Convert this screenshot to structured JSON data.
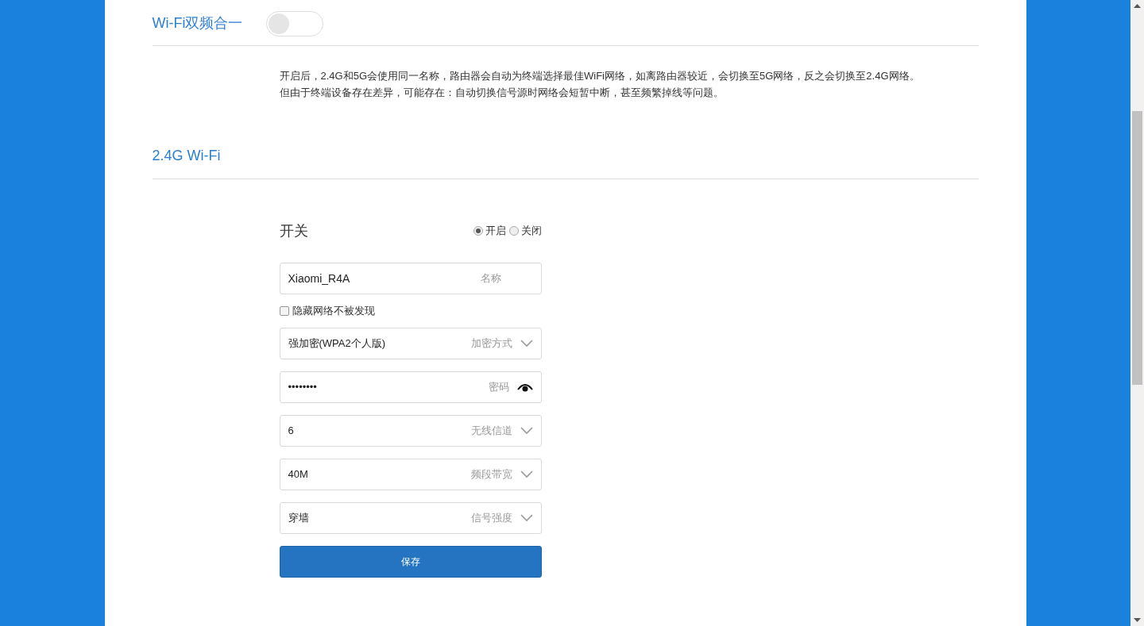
{
  "dual_band": {
    "label": "Wi-Fi双频合一",
    "on": false,
    "description": [
      "开启后，2.4G和5G会使用同一名称，路由器会自动为终端选择最佳WiFi网络，如离路由器较近，会切换至5G网络，反之会切换至2.4G网络。",
      "但由于终端设备存在差异，可能存在：自动切换信号源时网络会短暂中断，甚至频繁掉线等问题。"
    ]
  },
  "section": {
    "title": "2.4G Wi-Fi",
    "switch": {
      "label": "开关",
      "options": [
        {
          "label": "开启",
          "selected": true
        },
        {
          "label": "关闭",
          "selected": false
        }
      ]
    },
    "fields": [
      {
        "kind": "text",
        "value": "Xiaomi_R4A",
        "hint": "名称"
      },
      {
        "kind": "checkbox",
        "label": "隐藏网络不被发现",
        "checked": false
      },
      {
        "kind": "select",
        "value": "强加密(WPA2个人版)",
        "hint": "加密方式"
      },
      {
        "kind": "password",
        "value": "••••••••",
        "hint": "密码"
      },
      {
        "kind": "select",
        "value": "6",
        "hint": "无线信道"
      },
      {
        "kind": "select",
        "value": "40M",
        "hint": "频段带宽"
      },
      {
        "kind": "select",
        "value": "穿墙",
        "hint": "信号强度"
      }
    ],
    "save": "保存"
  }
}
